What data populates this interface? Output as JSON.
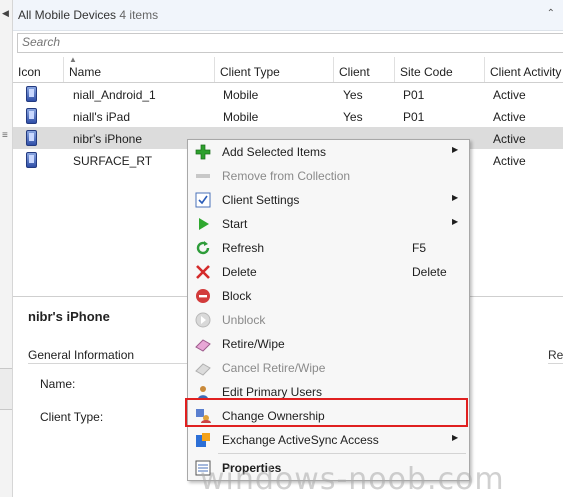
{
  "header": {
    "title": "All Mobile Devices",
    "count": "4 items"
  },
  "search": {
    "placeholder": "Search"
  },
  "columns": [
    "Icon",
    "Name",
    "Client Type",
    "Client",
    "Site Code",
    "Client Activity"
  ],
  "rows": [
    {
      "name": "niall_Android_1",
      "type": "Mobile",
      "client": "Yes",
      "site": "P01",
      "activity": "Active"
    },
    {
      "name": "niall's iPad",
      "type": "Mobile",
      "client": "Yes",
      "site": "P01",
      "activity": "Active"
    },
    {
      "name": "nibr's iPhone",
      "type": "",
      "client": "",
      "site": "",
      "activity": "Active",
      "selected": true
    },
    {
      "name": "SURFACE_RT",
      "type": "",
      "client": "",
      "site": "",
      "activity": "Active"
    }
  ],
  "details": {
    "title": "nibr's iPhone",
    "section": "General Information",
    "right_section": "Rel",
    "fields": [
      {
        "label": "Name:"
      },
      {
        "label": "Client Type:"
      }
    ]
  },
  "menu": [
    {
      "label": "Add Selected Items",
      "icon": "green-plus-icon",
      "submenu": true
    },
    {
      "label": "Remove from Collection",
      "icon": "remove-icon",
      "disabled": true
    },
    {
      "label": "Client Settings",
      "icon": "client-settings-icon",
      "submenu": true
    },
    {
      "label": "Start",
      "icon": "play-icon",
      "submenu": true
    },
    {
      "label": "Refresh",
      "icon": "refresh-icon",
      "shortcut": "F5"
    },
    {
      "label": "Delete",
      "icon": "delete-x-icon",
      "shortcut": "Delete"
    },
    {
      "label": "Block",
      "icon": "block-icon"
    },
    {
      "label": "Unblock",
      "icon": "unblock-icon",
      "disabled": true
    },
    {
      "label": "Retire/Wipe",
      "icon": "eraser-icon"
    },
    {
      "label": "Cancel Retire/Wipe",
      "icon": "cancel-eraser-icon",
      "disabled": true
    },
    {
      "label": "Edit Primary Users",
      "icon": "users-icon"
    },
    {
      "label": "Change Ownership",
      "icon": "ownership-icon",
      "highlighted": true
    },
    {
      "label": "Exchange ActiveSync Access",
      "icon": "activesync-icon",
      "submenu": true
    },
    {
      "label": "Properties",
      "icon": "properties-icon",
      "bold": true
    }
  ],
  "watermark": "windows-noob.com",
  "colors": {
    "highlight_box": "#e02020",
    "selected_row": "#dcdcdc",
    "menu_bg": "#f7f7f7"
  }
}
